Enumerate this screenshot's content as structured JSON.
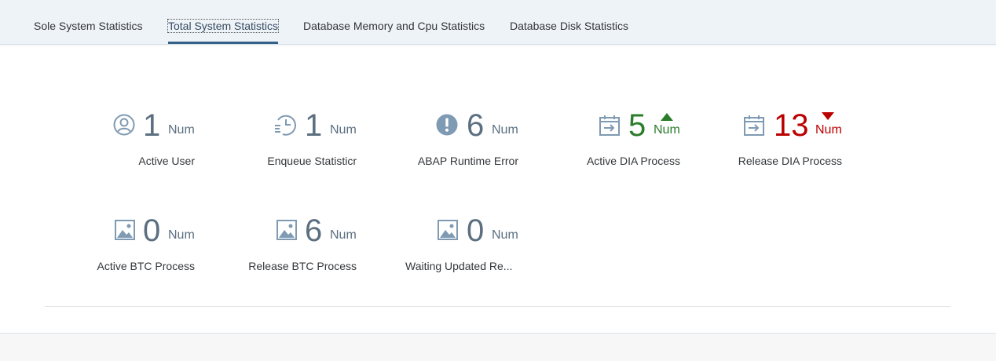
{
  "tabs": [
    {
      "label": "Sole System Statistics",
      "selected": false
    },
    {
      "label": "Total System Statistics",
      "selected": true
    },
    {
      "label": "Database Memory and Cpu Statistics",
      "selected": false
    },
    {
      "label": "Database Disk Statistics",
      "selected": false
    }
  ],
  "tiles": [
    {
      "value": "1",
      "unit": "Num",
      "label": "Active User",
      "icon": "user-icon"
    },
    {
      "value": "1",
      "unit": "Num",
      "label": "Enqueue Statisticr",
      "icon": "history-icon"
    },
    {
      "value": "6",
      "unit": "Num",
      "label": "ABAP Runtime Error",
      "icon": "error-icon"
    },
    {
      "value": "5",
      "unit": "Num",
      "label": "Active DIA Process",
      "icon": "calendar-process-icon",
      "trend": "up",
      "state": "good"
    },
    {
      "value": "13",
      "unit": "Num",
      "label": "Release DIA Process",
      "icon": "calendar-process-icon",
      "trend": "down",
      "state": "bad"
    },
    {
      "value": "0",
      "unit": "Num",
      "label": "Active BTC Process",
      "icon": "image-icon"
    },
    {
      "value": "6",
      "unit": "Num",
      "label": "Release BTC Process",
      "icon": "image-icon"
    },
    {
      "value": "0",
      "unit": "Num",
      "label": "Waiting Updated Re...",
      "icon": "image-icon"
    }
  ],
  "colors": {
    "icon": "#7f9ab3",
    "good": "#2b7c2b",
    "bad": "#bb0000",
    "neutral": "#5b6f80"
  }
}
